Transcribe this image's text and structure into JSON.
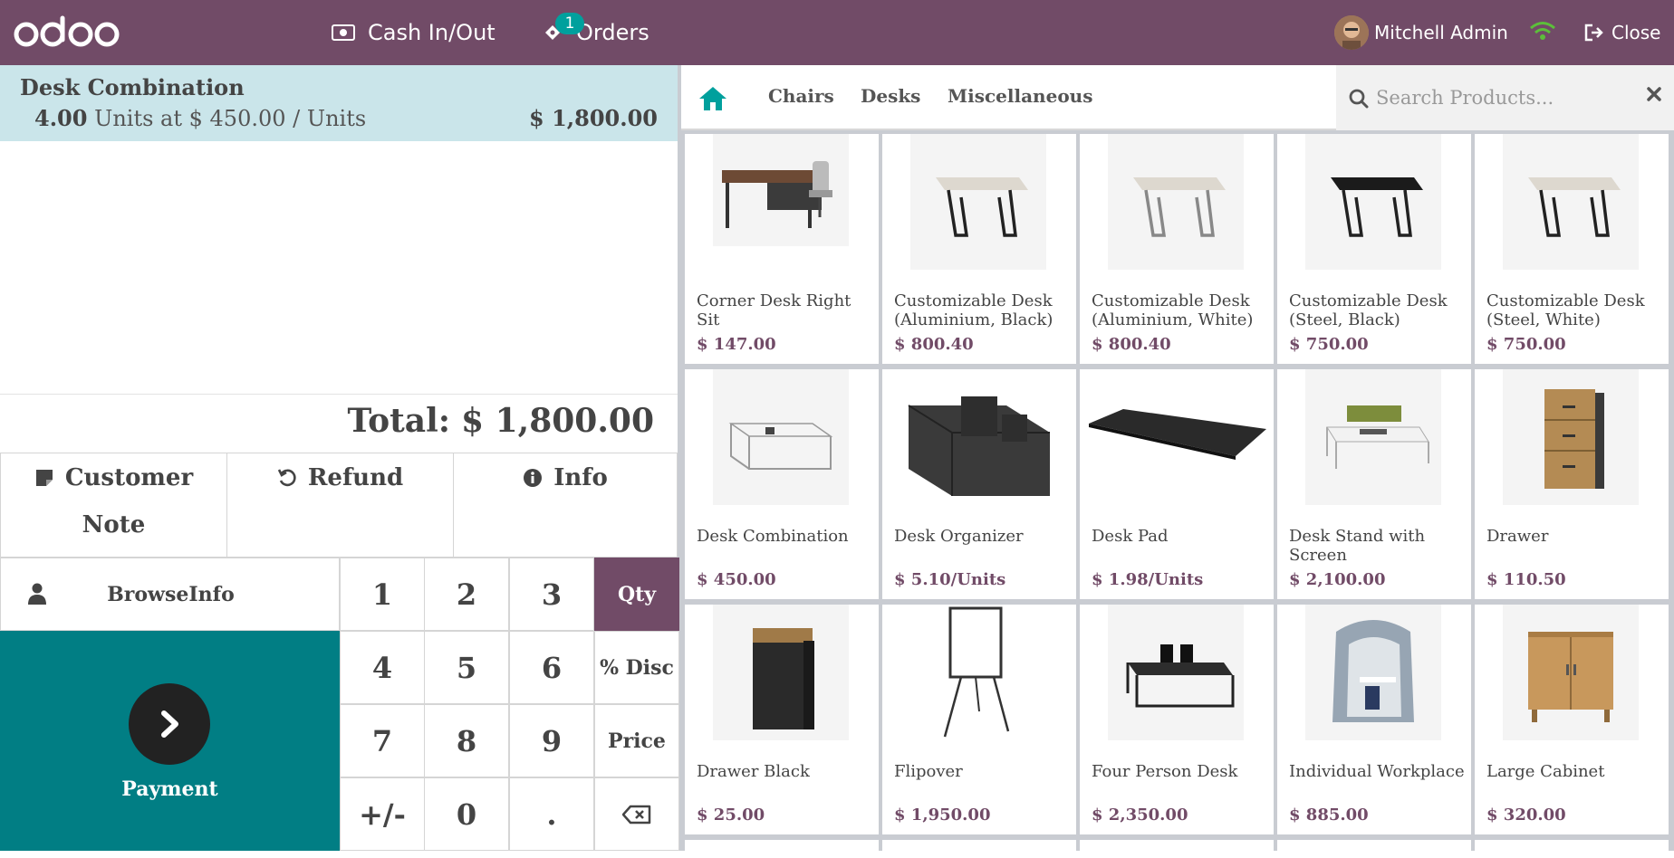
{
  "topbar": {
    "logo": "odoo",
    "cash_label": "Cash In/Out",
    "orders_label": "Orders",
    "orders_badge": "1",
    "user_name": "Mitchell Admin",
    "close_label": "Close",
    "bg_color": "#714B67"
  },
  "order": {
    "line": {
      "name": "Desk Combination",
      "qty": "4.00",
      "unit_text": "Units at $ 450.00 / Units",
      "price": "$ 1,800.00"
    },
    "total_label": "Total:",
    "total_value": "$ 1,800.00"
  },
  "controls": {
    "customer_note_line1": "Customer",
    "customer_note_line2": "Note",
    "refund_label": "Refund",
    "info_label": "Info",
    "customer_label": "BrowseInfo",
    "payment_label": "Payment"
  },
  "numpad": {
    "keys": [
      "1",
      "2",
      "3",
      "Qty",
      "4",
      "5",
      "6",
      "% Disc",
      "7",
      "8",
      "9",
      "Price",
      "+/-",
      "0",
      "."
    ],
    "active_mode": "Qty"
  },
  "categories": {
    "items": [
      "Chairs",
      "Desks",
      "Miscellaneous"
    ],
    "search_placeholder": "Search Products..."
  },
  "products": [
    {
      "name": "Corner Desk Right Sit",
      "price": "$ 147.00",
      "icon": "desk-office-icon"
    },
    {
      "name": "Customizable Desk (Aluminium, Black)",
      "price": "$ 800.40",
      "icon": "desk-white-top-icon"
    },
    {
      "name": "Customizable Desk (Aluminium, White)",
      "price": "$ 800.40",
      "icon": "desk-white-top-icon"
    },
    {
      "name": "Customizable Desk (Steel, Black)",
      "price": "$ 750.00",
      "icon": "desk-black-top-icon"
    },
    {
      "name": "Customizable Desk (Steel, White)",
      "price": "$ 750.00",
      "icon": "desk-white-top-icon"
    },
    {
      "name": "Desk Combination",
      "price": "$ 450.00",
      "icon": "desk-combination-icon"
    },
    {
      "name": "Desk Organizer",
      "price": "$ 5.10/Units",
      "icon": "desk-organizer-icon"
    },
    {
      "name": "Desk Pad",
      "price": "$ 1.98/Units",
      "icon": "desk-pad-icon"
    },
    {
      "name": "Desk Stand with Screen",
      "price": "$ 2,100.00",
      "icon": "desk-stand-icon"
    },
    {
      "name": "Drawer",
      "price": "$ 110.50",
      "icon": "drawer-icon"
    },
    {
      "name": "Drawer Black",
      "price": "$ 25.00",
      "icon": "drawer-black-icon"
    },
    {
      "name": "Flipover",
      "price": "$ 1,950.00",
      "icon": "flipover-icon"
    },
    {
      "name": "Four Person Desk",
      "price": "$ 2,350.00",
      "icon": "four-person-desk-icon"
    },
    {
      "name": "Individual Workplace",
      "price": "$ 885.00",
      "icon": "workplace-pod-icon"
    },
    {
      "name": "Large Cabinet",
      "price": "$ 320.00",
      "icon": "cabinet-icon"
    }
  ]
}
